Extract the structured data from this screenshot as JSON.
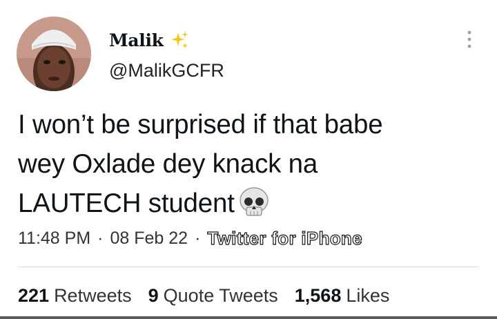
{
  "author": {
    "display_name": "Malik",
    "handle": "@MalikGCFR",
    "badge_icon": "sparkles-icon"
  },
  "tweet": {
    "text_line1": "I won’t be surprised if that babe",
    "text_line2": "wey Oxlade dey knack na",
    "text_line3": "LAUTECH student",
    "trailing_emoji": "skull-icon"
  },
  "meta": {
    "time": "11:48 PM",
    "separator": "·",
    "date": "08 Feb 22",
    "source": "Twitter for iPhone"
  },
  "stats": {
    "retweets_count": "221",
    "retweets_label": "Retweets",
    "quotes_count": "9",
    "quotes_label": "Quote Tweets",
    "likes_count": "1,568",
    "likes_label": "Likes"
  },
  "colors": {
    "text": "#0f1419",
    "secondary": "#333333",
    "divider": "#dcdcdc",
    "sparkle": "#f5c518"
  }
}
